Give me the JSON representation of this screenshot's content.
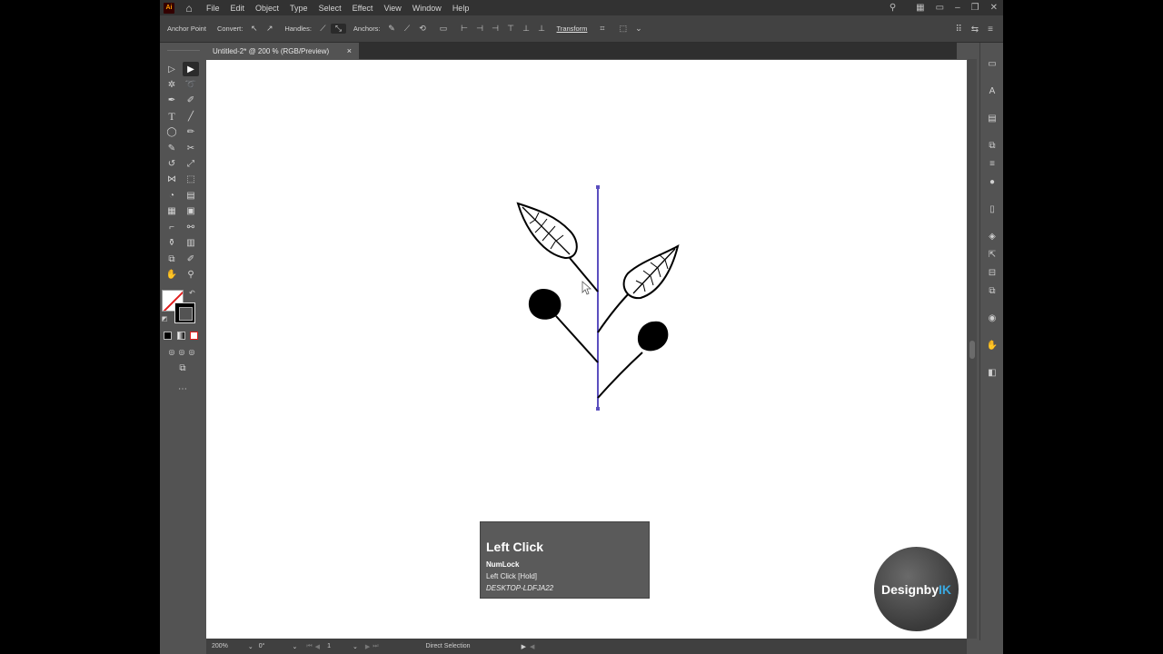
{
  "app": {
    "logo": "Ai",
    "menus": [
      "File",
      "Edit",
      "Object",
      "Type",
      "Select",
      "Effect",
      "View",
      "Window",
      "Help"
    ]
  },
  "controlbar": {
    "anchor_point_label": "Anchor Point",
    "convert_label": "Convert:",
    "handles_label": "Handles:",
    "anchors_label": "Anchors:",
    "transform_label": "Transform"
  },
  "document": {
    "tab_title": "Untitled-2* @ 200 % (RGB/Preview)",
    "close_glyph": "×"
  },
  "statusbar": {
    "zoom": "200%",
    "rotation": "0°",
    "artboard": "1",
    "tool": "Direct Selection"
  },
  "key_overlay": {
    "action": "Left Click",
    "modifier": "NumLock",
    "detail": "Left Click [Hold]",
    "host": "DESKTOP-LDFJA22"
  },
  "watermark": {
    "brand_main": "Designby",
    "brand_accent": "IK",
    "accent_color": "#3aa9e0"
  },
  "colors": {
    "ui_background": "#535353",
    "menubar": "#323232",
    "path_highlight": "#5b4fbf"
  }
}
